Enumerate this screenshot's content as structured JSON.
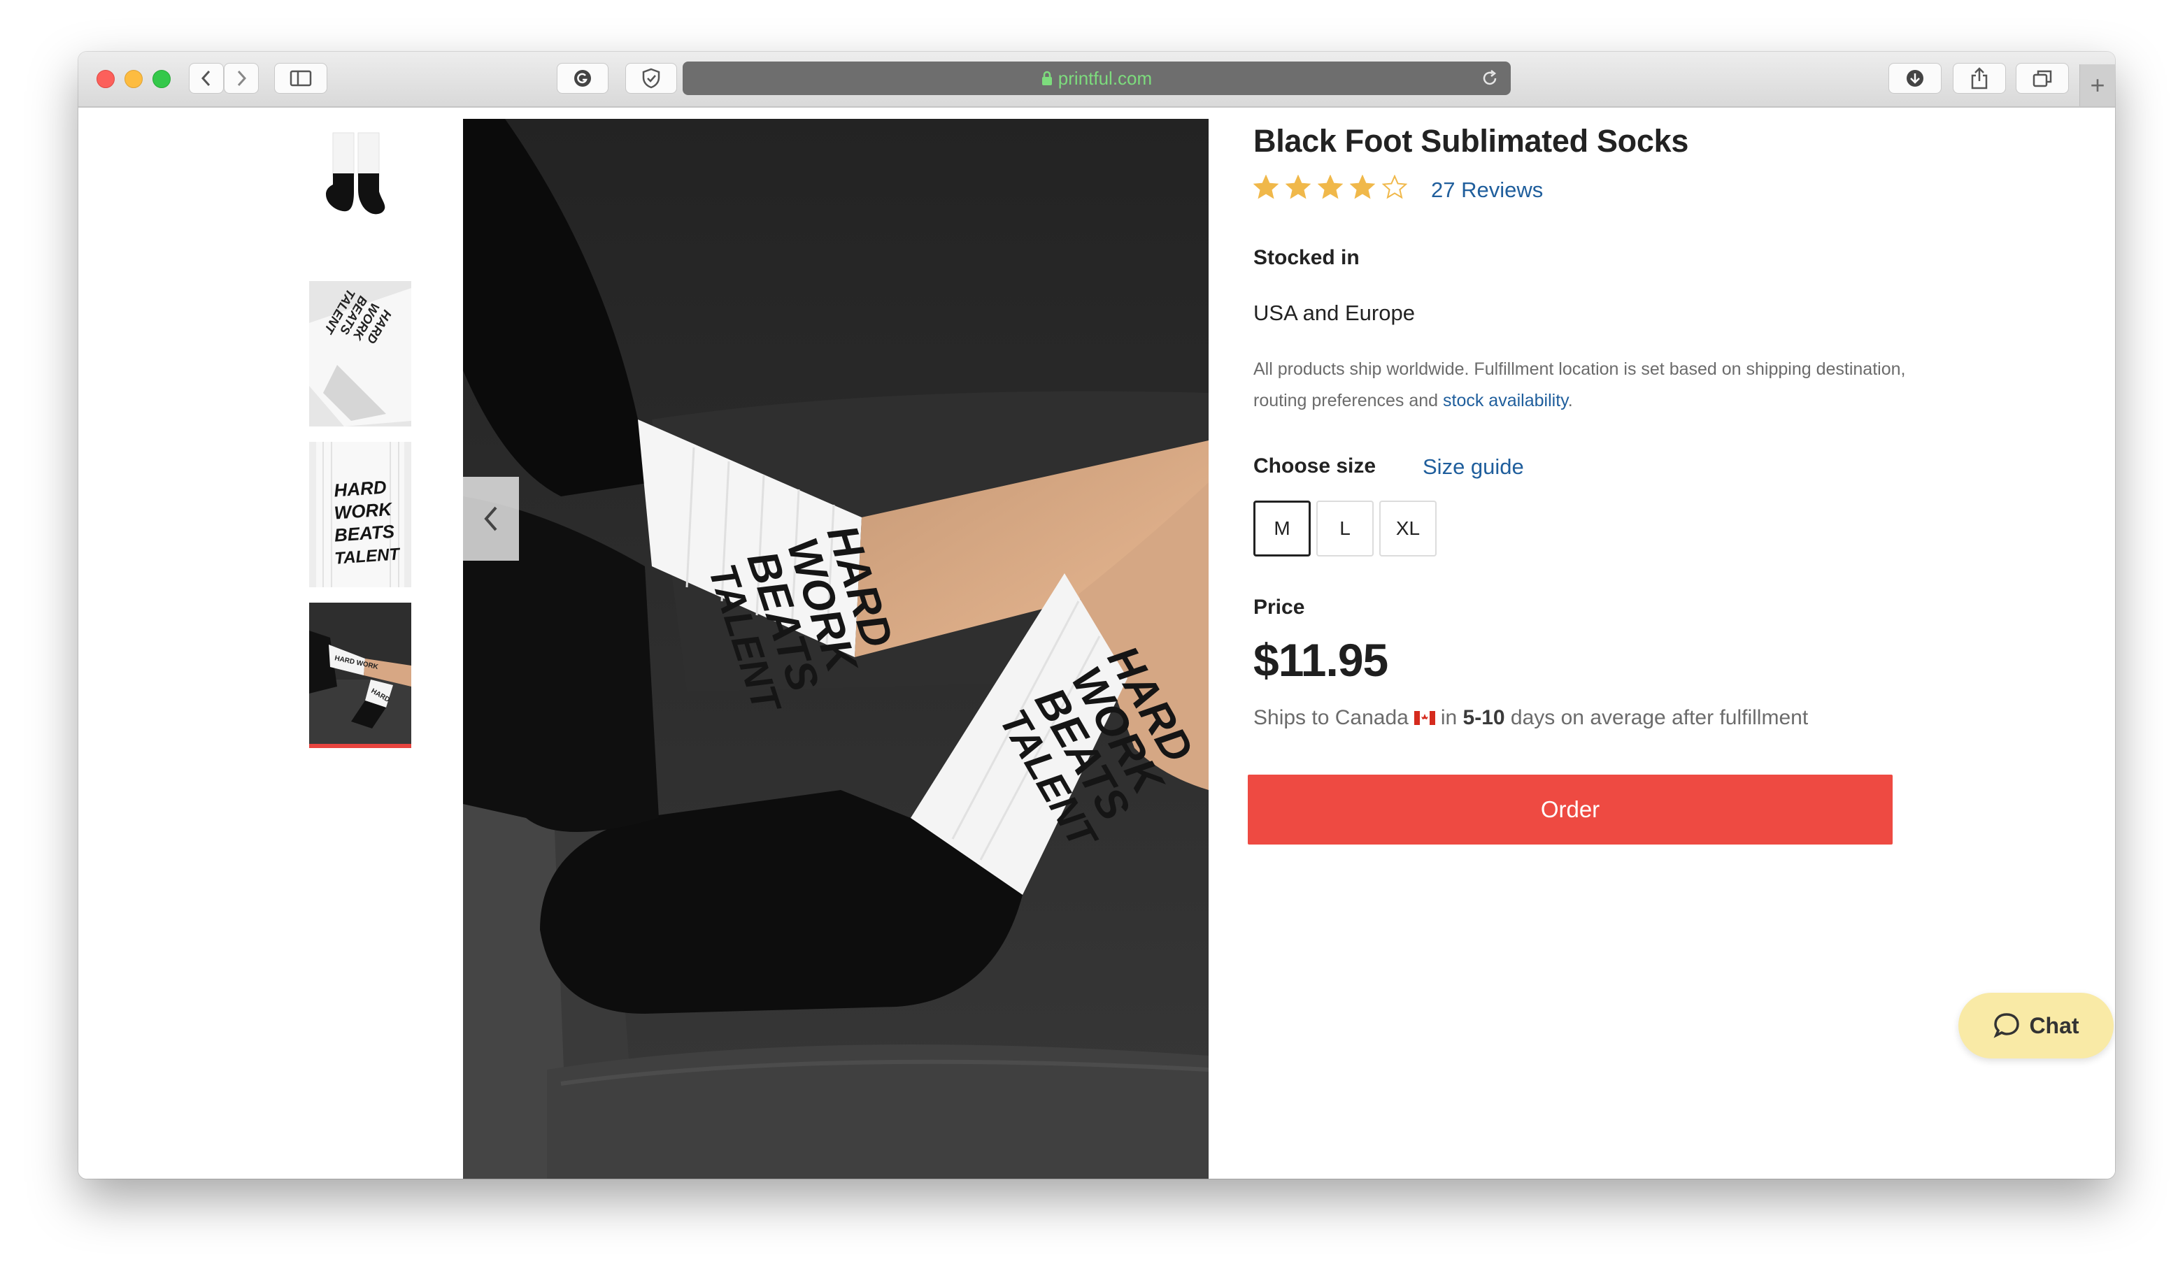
{
  "browser": {
    "url": "printful.com",
    "new_tab_label": "+"
  },
  "product": {
    "title": "Black Foot Sublimated Socks",
    "rating": 4,
    "rating_max": 5,
    "reviews_link": "27 Reviews",
    "stocked_in_label": "Stocked in",
    "stocked_in_value": "USA and Europe",
    "fulfillment_note": "All products ship worldwide. Fulfillment location is set based on shipping destination, routing preferences and",
    "stock_link": "stock availability",
    "note_end": ".",
    "choose_size_label": "Choose size",
    "size_guide_link": "Size guide",
    "sizes": [
      "M",
      "L",
      "XL"
    ],
    "selected_size": "M",
    "price_label": "Price",
    "price": "$11.95",
    "shipping": {
      "prefix": "Ships to Canada",
      "middle": "in",
      "days": "5-10",
      "suffix": "days on average after fulfillment"
    },
    "order_button": "Order"
  },
  "gallery": {
    "hero_print_text": [
      "HARD",
      "WORK",
      "BEATS",
      "TALENT"
    ],
    "thumbnails": [
      "thumbnail-socks-pair",
      "thumbnail-sock-flat",
      "thumbnail-sock-print",
      "thumbnail-socks-lifestyle"
    ],
    "active_thumbnail": 3
  },
  "chat_button": "Chat",
  "colors": {
    "accent": "#ee4a42",
    "link": "#1f5e9c",
    "star": "#f0b84a",
    "chat_bg": "#f9eaa6"
  }
}
